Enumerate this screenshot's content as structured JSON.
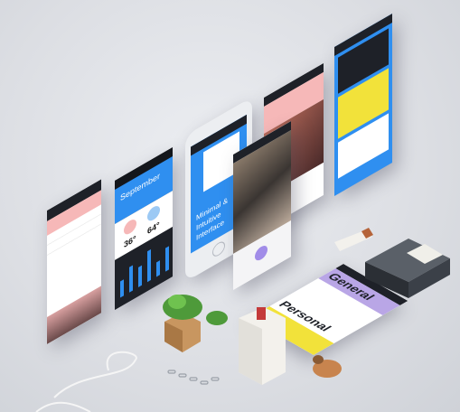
{
  "screens": {
    "calendar": {
      "month": "September",
      "temp_left": "36°",
      "temp_right": "64°"
    },
    "phone": {
      "headline_line1": "Minimal &",
      "headline_line2": "Intuitive",
      "headline_line3": "Interface"
    },
    "settings": {
      "section_1": "General",
      "section_2": "Personal"
    }
  },
  "colors": {
    "accent_blue": "#2f8ff0",
    "accent_pink": "#f6b8b8",
    "accent_yellow": "#f2e23a",
    "dark_panel": "#1e2128",
    "lavender": "#b9a6e6"
  }
}
